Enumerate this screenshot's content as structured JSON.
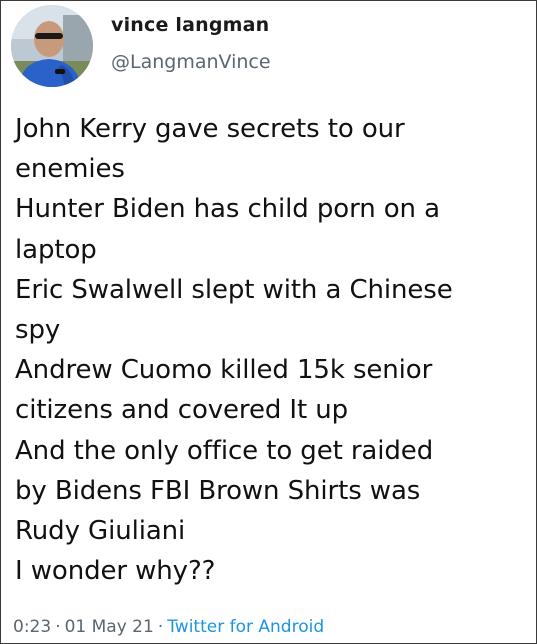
{
  "author": {
    "display_name": "vince langman",
    "handle": "@LangmanVince",
    "avatar_icon": "profile-photo"
  },
  "tweet": {
    "lines": [
      "John Kerry gave secrets to our",
      "enemies",
      "Hunter Biden has child porn on a",
      "laptop",
      "Eric Swalwell slept with a Chinese",
      "spy",
      "Andrew Cuomo killed 15k senior",
      "citizens and covered It up",
      "And the only office to get raided",
      "by Bidens FBI Brown Shirts was",
      "Rudy Giuliani",
      "I wonder why??"
    ]
  },
  "meta": {
    "time": "0:23",
    "separator": "·",
    "date": "01 May 21",
    "source": "Twitter for Android"
  },
  "colors": {
    "text": "#111111",
    "muted": "#5b6670",
    "link": "#1b95e0"
  }
}
